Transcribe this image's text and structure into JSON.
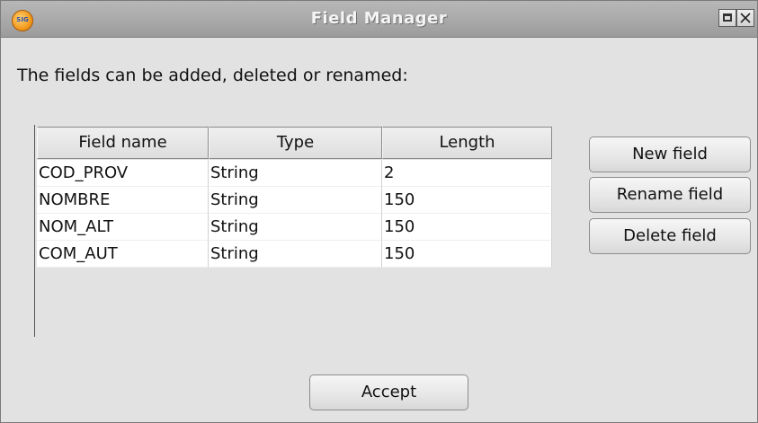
{
  "window": {
    "title": "Field Manager",
    "app_icon": "gvsig-sextante-icon",
    "app_icon_text": "SIG",
    "controls": [
      "maximize-icon",
      "close-icon"
    ]
  },
  "dialog": {
    "prompt": "The fields can be added, deleted or renamed:"
  },
  "table": {
    "columns": [
      "Field name",
      "Type",
      "Length"
    ],
    "rows": [
      [
        "COD_PROV",
        "String",
        "2"
      ],
      [
        "NOMBRE",
        "String",
        "150"
      ],
      [
        "NOM_ALT",
        "String",
        "150"
      ],
      [
        "COM_AUT",
        "String",
        "150"
      ]
    ]
  },
  "buttons": {
    "new_field": "New field",
    "rename_field": "Rename field",
    "delete_field": "Delete field",
    "accept": "Accept"
  },
  "colors": {
    "titlebar": "#a9a9a9",
    "window_bg": "#e2e2e2",
    "table_bg": "#ffffff"
  }
}
